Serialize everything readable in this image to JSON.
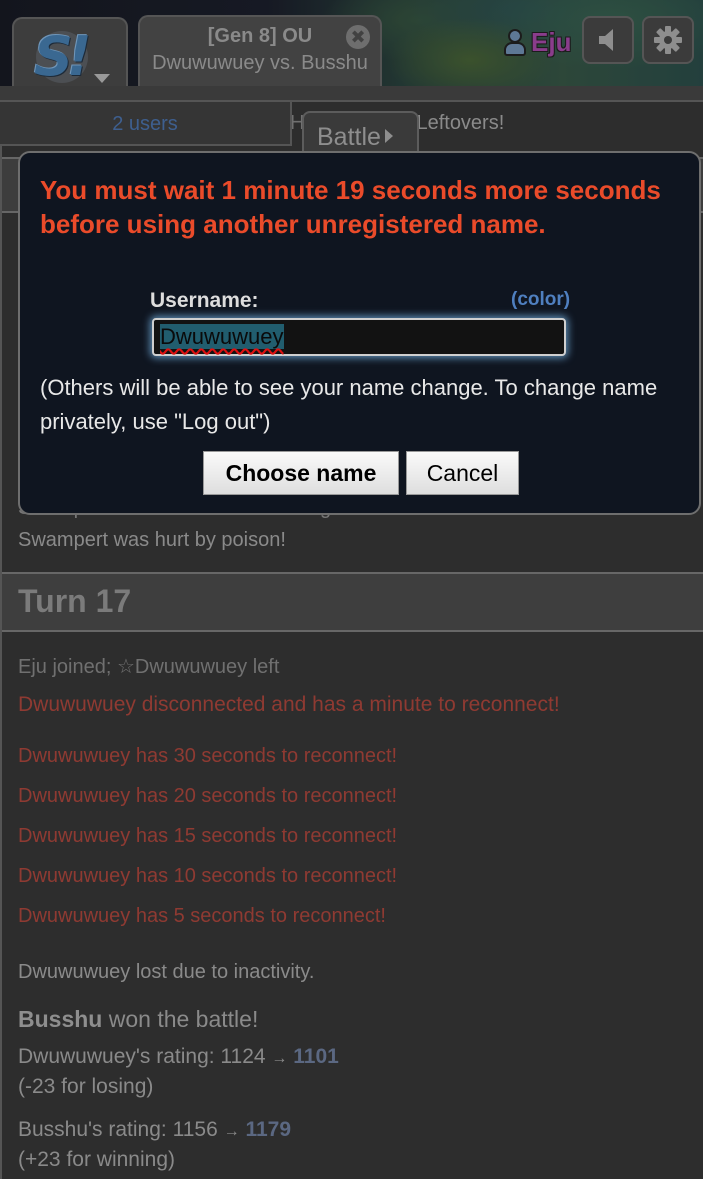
{
  "header": {
    "logo_text": "S!",
    "room_tab": {
      "format": "[Gen 8] OU",
      "matchup": "Dwuwuwuey vs. Busshu",
      "close_glyph": "✖"
    },
    "user": {
      "name": "Eju",
      "name_color": "#8a3d8c"
    },
    "icons": {
      "sound": "sound-icon",
      "settings": "gear-icon"
    }
  },
  "subbar": {
    "users_label": "2 users",
    "battle_button": "Battle",
    "peek_text_prefix": "H",
    "peek_text": "Leftovers!"
  },
  "dialog": {
    "error": "You must wait 1 minute 19 seconds more seconds before using another unregistered name.",
    "username_label": "Username:",
    "color_link": "(color)",
    "username_value": "Dwuwuwuey",
    "note": "(Others will be able to see your name change. To change name privately, use \"Log out\")",
    "choose_button": "Choose name",
    "cancel_button": "Cancel"
  },
  "log": {
    "hidden_line": "Swampert restored a little HP using its Leftovers!",
    "poison_line": "Swampert was hurt by poison!",
    "turn_label": "Turn 17",
    "join_line": "Eju joined; ☆Dwuwuwuey left",
    "disconnect_line": "Dwuwuwuey disconnected and has a minute to reconnect!",
    "reconnect_lines": [
      "Dwuwuwuey has 30 seconds to reconnect!",
      "Dwuwuwuey has 20 seconds to reconnect!",
      "Dwuwuwuey has 15 seconds to reconnect!",
      "Dwuwuwuey has 10 seconds to reconnect!",
      "Dwuwuwuey has 5 seconds to reconnect!"
    ],
    "inactivity_line": "Dwuwuwuey lost due to inactivity.",
    "winner": "Busshu",
    "winner_suffix": " won the battle!",
    "ratings": [
      {
        "prefix": "Dwuwuwuey's rating: 1124 ",
        "arrow": "→",
        "new": "1101",
        "change": "(-23 for losing)"
      },
      {
        "prefix": "Busshu's rating: 1156 ",
        "arrow": "→",
        "new": "1179",
        "change": "(+23 for winning)"
      }
    ]
  },
  "colors": {
    "error_text": "#ea4b2a",
    "reconnect_text": "#8f3a32",
    "rating_new": "#5b6882",
    "link": "#4f7fbf"
  }
}
